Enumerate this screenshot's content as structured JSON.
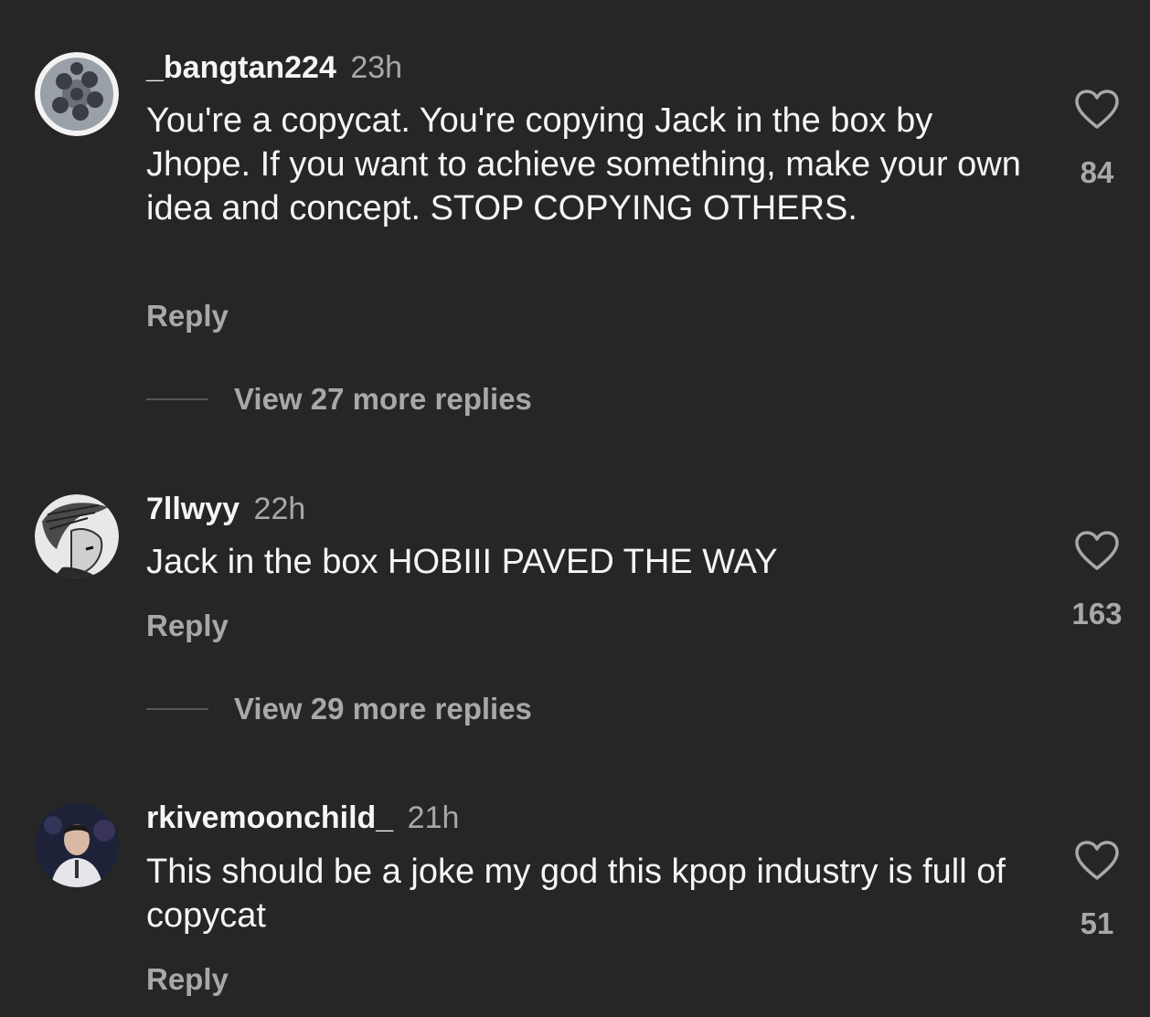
{
  "comments": [
    {
      "username": "_bangtan224",
      "time": "23h",
      "text": "You're a copycat. You're copying Jack in the box by Jhope. If you want to achieve something, make your own idea and concept. STOP COPYING OTHERS.",
      "reply_label": "Reply",
      "view_more": "View 27 more replies",
      "likes": "84",
      "avatar_icon": "group-photo-avatar"
    },
    {
      "username": "7llwyy",
      "time": "22h",
      "text": "Jack in the box HOBIII PAVED THE WAY",
      "reply_label": "Reply",
      "view_more": "View 29 more replies",
      "likes": "163",
      "avatar_icon": "sketch-drawing-avatar"
    },
    {
      "username": "rkivemoonchild_",
      "time": "21h",
      "text": "This should be a joke my god this kpop industry is full of copycat",
      "reply_label": "Reply",
      "likes": "51",
      "avatar_icon": "concert-photo-avatar"
    }
  ],
  "colors": {
    "background": "#262626",
    "primary_text": "#f5f5f5",
    "secondary_text": "#a8a8a8"
  }
}
